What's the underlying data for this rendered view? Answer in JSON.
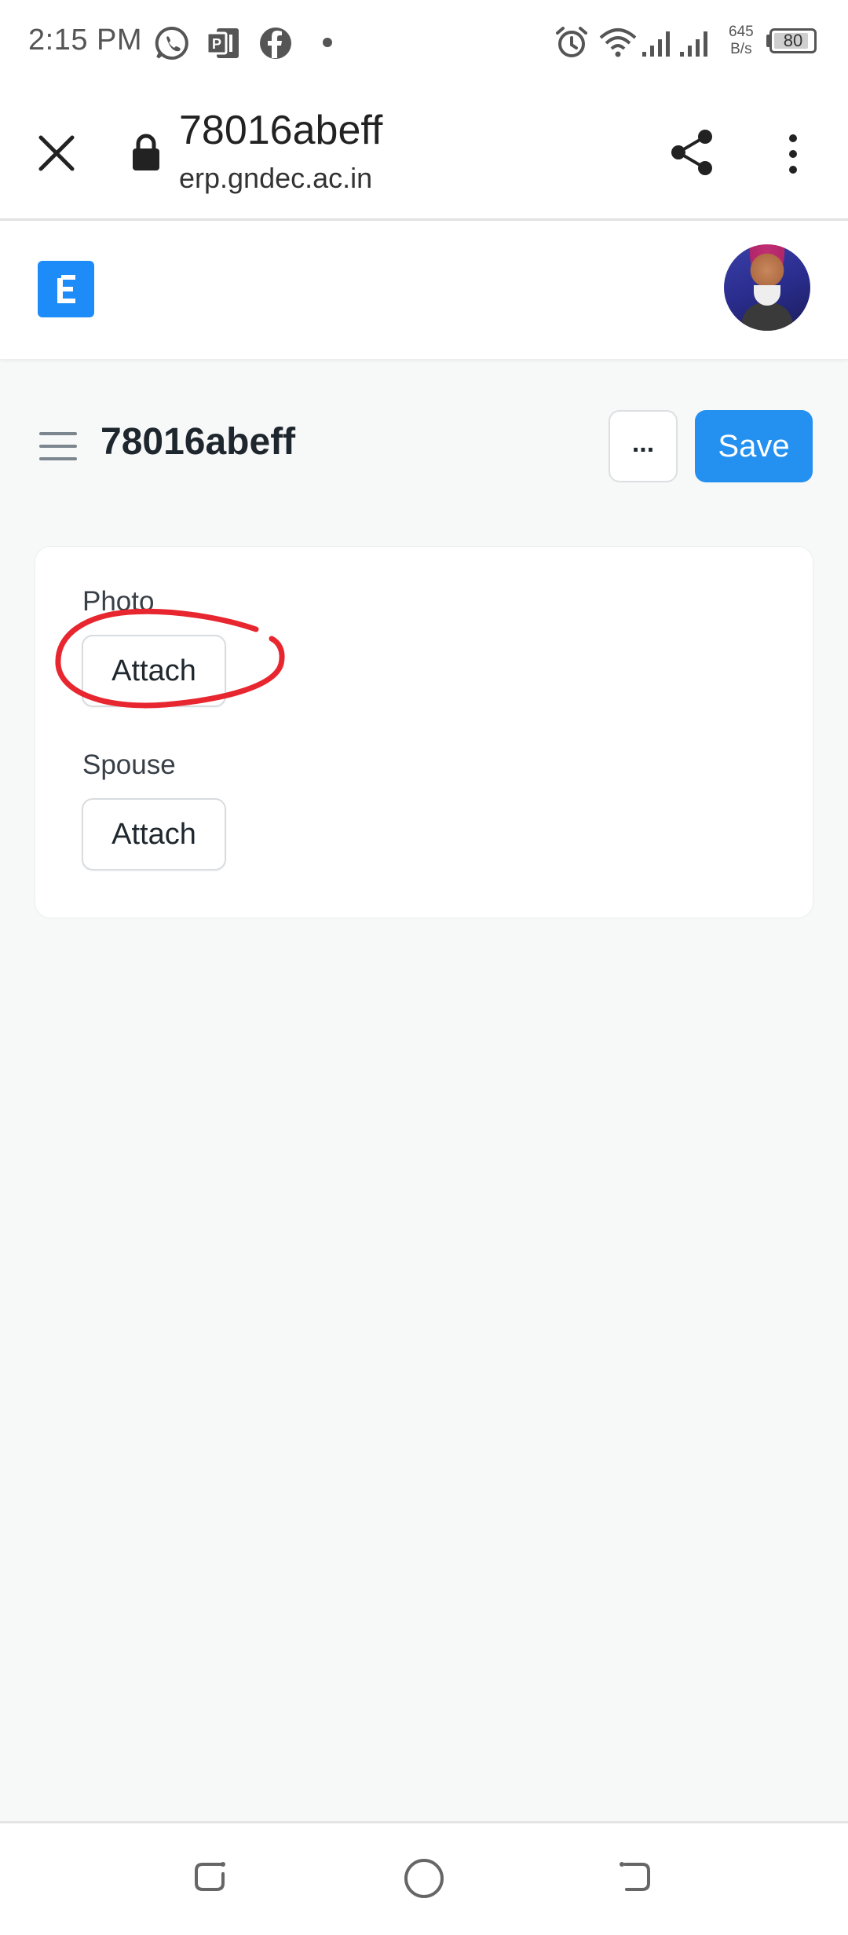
{
  "status_bar": {
    "time": "2:15 PM",
    "network_speed_value": "645",
    "network_speed_unit": "B/s",
    "battery_level": "80",
    "icons": [
      "whatsapp-icon",
      "teams-icon",
      "facebook-icon",
      "dot-icon",
      "alarm-icon",
      "wifi-icon",
      "signal-icon",
      "signal-icon-2",
      "battery-icon"
    ]
  },
  "browser": {
    "tab_title": "78016abeff",
    "url": "erp.gndec.ac.in",
    "icons": [
      "close-icon",
      "lock-icon",
      "share-icon",
      "more-vert-icon"
    ]
  },
  "app_header": {
    "logo_letter": "E",
    "brand_color": "#1d8cf8"
  },
  "page": {
    "title": "78016abeff",
    "more_label": "...",
    "save_label": "Save",
    "accent_color": "#2490ef"
  },
  "form": {
    "fields": [
      {
        "label": "Photo",
        "button_label": "Attach"
      },
      {
        "label": "Spouse",
        "button_label": "Attach"
      }
    ]
  },
  "annotation": {
    "color": "#e8262f",
    "shape": "hand-drawn-circle"
  },
  "nav_bar": {
    "icons": [
      "recent-apps-icon",
      "home-icon",
      "back-icon"
    ]
  }
}
